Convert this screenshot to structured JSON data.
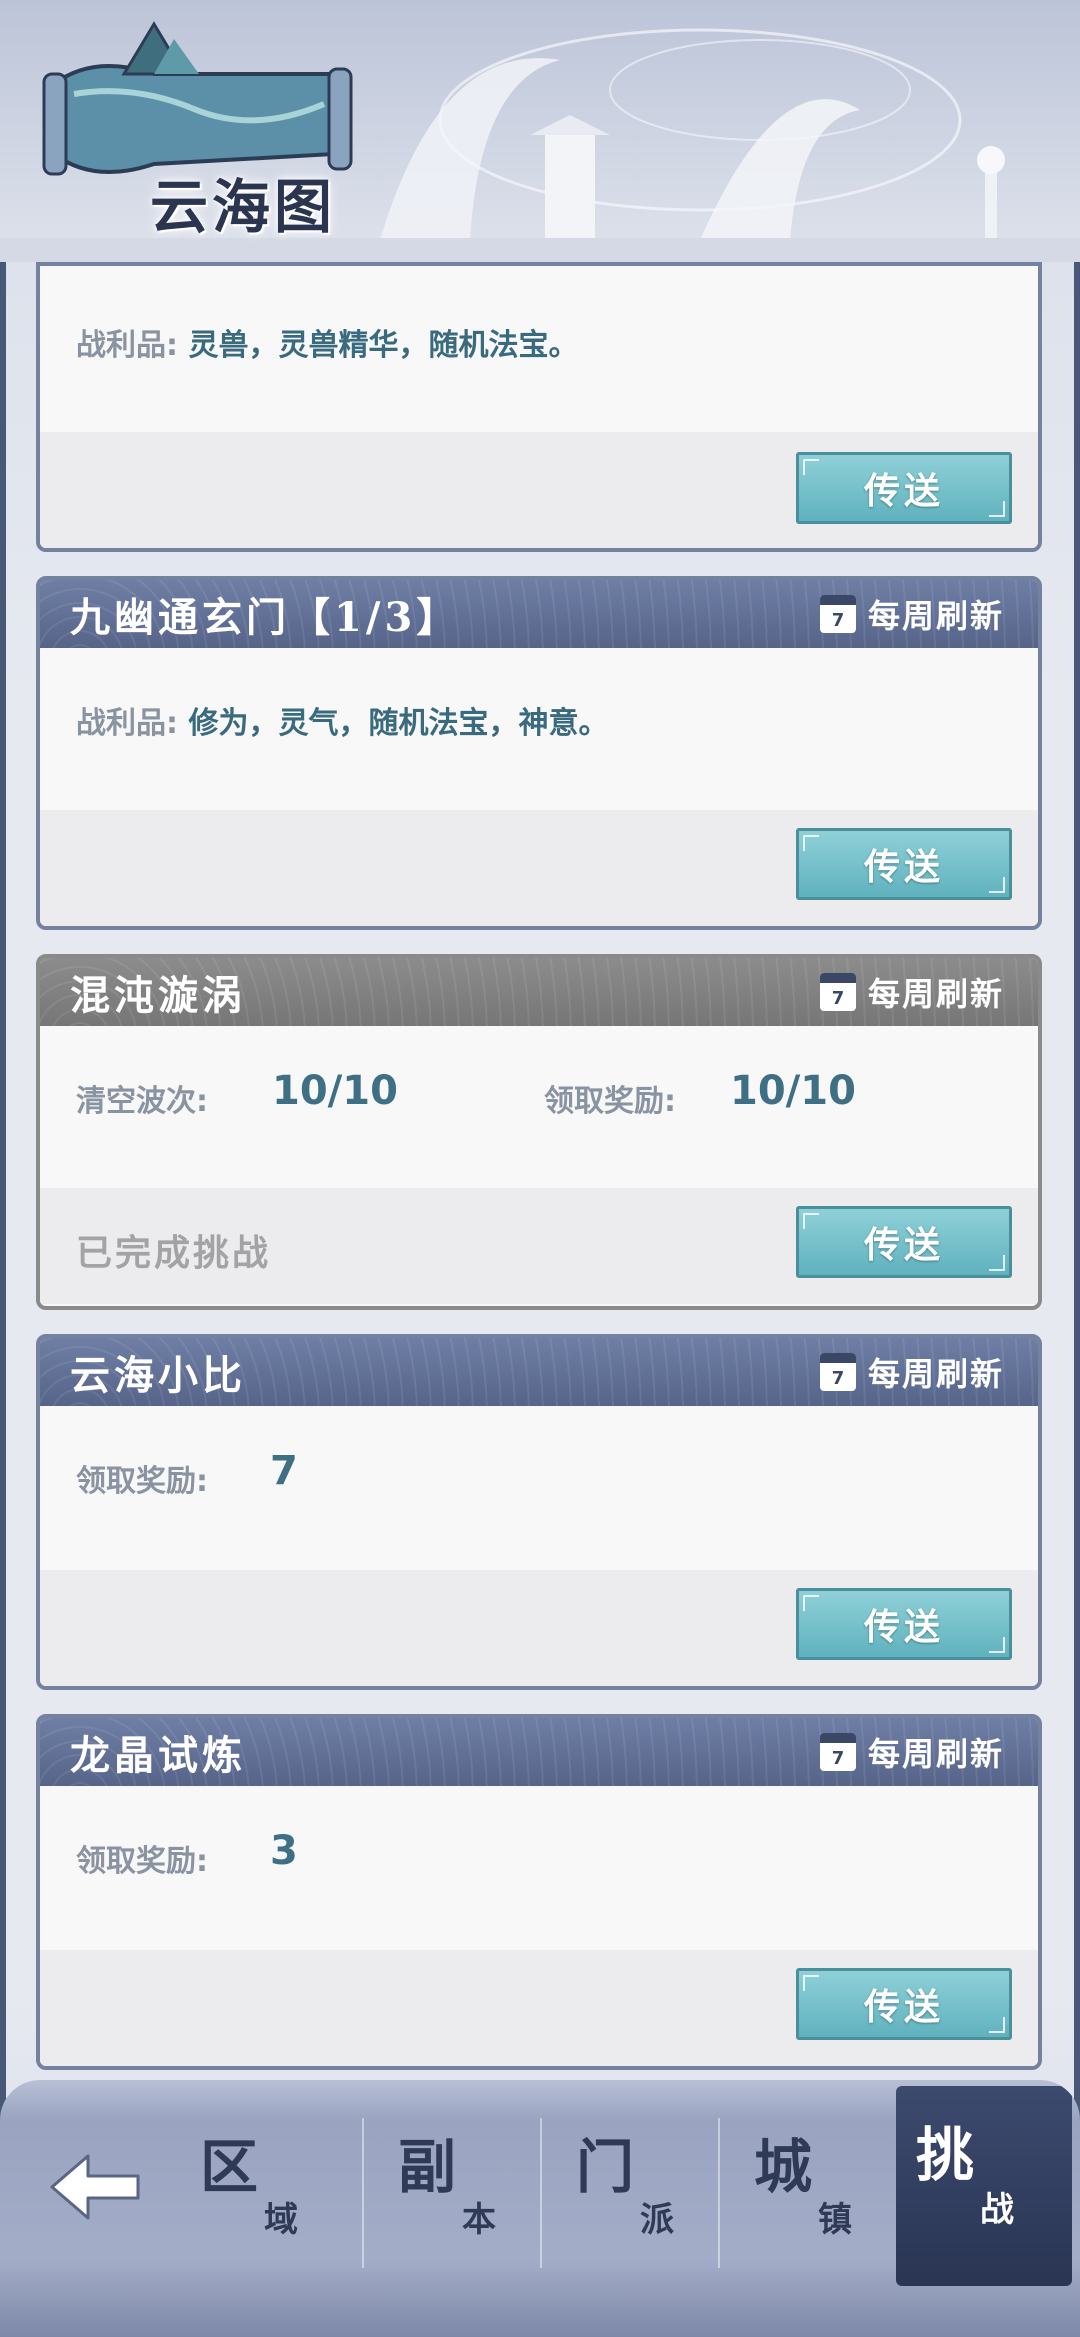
{
  "header": {
    "title": "云海图"
  },
  "common": {
    "refresh_label": "每周刷新",
    "calendar_day": "7",
    "send_label": "传送"
  },
  "cards": [
    {
      "loot_label": "战利品:",
      "loot_value": "灵兽，灵兽精华，随机法宝。"
    },
    {
      "title": "九幽通玄门【1/3】",
      "loot_label": "战利品:",
      "loot_value": "修为，灵气，随机法宝，神意。"
    },
    {
      "title": "混沌漩涡",
      "stat1_label": "清空波次:",
      "stat1_value": "10/10",
      "stat2_label": "领取奖励:",
      "stat2_value": "10/10",
      "status": "已完成挑战"
    },
    {
      "title": "云海小比",
      "stat1_label": "领取奖励:",
      "stat1_value": "7"
    },
    {
      "title": "龙晶试炼",
      "stat1_label": "领取奖励:",
      "stat1_value": "3"
    }
  ],
  "nav": {
    "tabs": [
      {
        "big": "区",
        "small": "域"
      },
      {
        "big": "副",
        "small": "本"
      },
      {
        "big": "门",
        "small": "派"
      },
      {
        "big": "城",
        "small": "镇"
      },
      {
        "big": "挑",
        "small": "战"
      }
    ],
    "active_index": 4
  },
  "colors": {
    "accent": "#5fb2be",
    "header_blue": "#56648a",
    "nav": "#9aa4c0"
  }
}
